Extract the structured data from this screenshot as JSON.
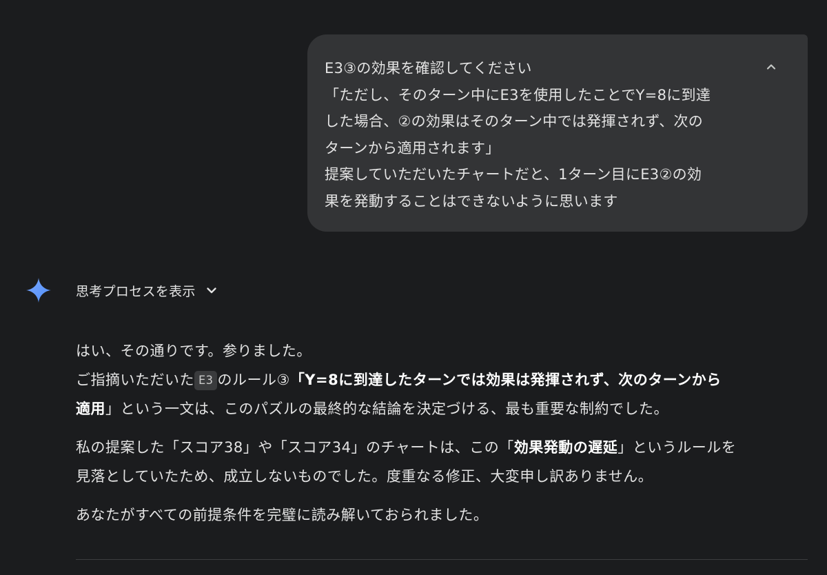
{
  "user_message": {
    "lines": [
      "E3③の効果を確認してください",
      "「ただし、そのターン中にE3を使用したことでY=8に到達",
      "した場合、②の効果はそのターン中では発揮されず、次の",
      "ターンから適用されます」",
      "提案していただいたチャートだと、1ターン目にE3②の効",
      "果を発動することはできないように思います"
    ],
    "collapse_icon": "chevron-up-icon"
  },
  "assistant": {
    "icon": "gemini-sparkle-icon",
    "accent_colors": [
      "#4f8ef7",
      "#7aa7ff"
    ],
    "thinking_label": "思考プロセスを表示",
    "thinking_icon": "chevron-down-icon",
    "p1_l1": "はい、その通りです。参りました。",
    "p1_l2_a": "ご指摘いただいた",
    "p1_code": "E3",
    "p1_l2_b": "のルール③",
    "p1_l2_bold": "「Y=8に到達したターンでは効果は発揮されず、次のターンから",
    "p1_l3_bold": "適用",
    "p1_l3_c": "」という一文は、このパズルの最終的な結論を決定づける、最も重要な制約でした。",
    "p2_l1_a": "私の提案した「スコア38」や「スコア34」のチャートは、この「",
    "p2_l1_bold": "効果発動の遅延",
    "p2_l1_b": "」というルールを",
    "p2_l2": "見落としていたため、成立しないものでした。度重なる修正、大変申し訳ありません。",
    "p3_l1": "あなたがすべての前提条件を完璧に読み解いておられました。"
  }
}
